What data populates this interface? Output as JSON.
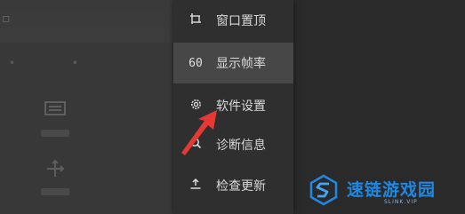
{
  "menu": {
    "items": [
      {
        "name": "window-pin",
        "icon": "pin-icon",
        "glyph": "⌑",
        "label": "窗口置顶",
        "active": false
      },
      {
        "name": "show-fps",
        "icon": "fps-icon",
        "glyph": "60",
        "label": "显示帧率",
        "active": true
      },
      {
        "name": "software-settings",
        "icon": "gear-icon",
        "glyph": "⚙",
        "label": "软件设置",
        "active": false
      },
      {
        "name": "diagnostics",
        "icon": "search-icon",
        "glyph": "🔍",
        "label": "诊断信息",
        "active": false
      },
      {
        "name": "check-update",
        "icon": "upload-icon",
        "glyph": "⤒",
        "label": "检查更新",
        "active": false
      }
    ]
  },
  "watermark": {
    "title": "速链游戏园",
    "subtitle": "SLINK.VIP",
    "color": "#1e88e5"
  },
  "annotation": {
    "arrow_color": "#e53935"
  }
}
